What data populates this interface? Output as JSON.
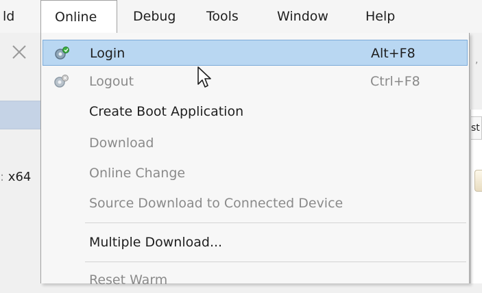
{
  "menubar": {
    "items": [
      {
        "label": "ld"
      },
      {
        "label": "Online"
      },
      {
        "label": "Debug"
      },
      {
        "label": "Tools"
      },
      {
        "label": "Window"
      },
      {
        "label": "Help"
      }
    ]
  },
  "background": {
    "left_text": "x64",
    "right_tab_text": "st"
  },
  "online_menu": {
    "items": [
      {
        "label": "Login",
        "shortcut": "Alt+F8",
        "state": "highlighted",
        "icon": "login-gear-icon"
      },
      {
        "label": "Logout",
        "shortcut": "Ctrl+F8",
        "state": "disabled",
        "icon": "logout-gear-icon"
      },
      {
        "label": "Create Boot Application",
        "shortcut": "",
        "state": "enabled"
      },
      {
        "label": "Download",
        "shortcut": "",
        "state": "disabled"
      },
      {
        "label": "Online Change",
        "shortcut": "",
        "state": "disabled"
      },
      {
        "label": "Source Download to Connected Device",
        "shortcut": "",
        "state": "disabled"
      },
      {
        "label": "Multiple Download...",
        "shortcut": "",
        "state": "enabled"
      },
      {
        "label": "Reset Warm",
        "shortcut": "",
        "state": "disabled"
      }
    ]
  },
  "colors": {
    "highlight_bg": "#b9d7f2",
    "highlight_border": "#7aaad8",
    "disabled_text": "#8a8a8a",
    "enabled_text": "#1e1e1e"
  }
}
